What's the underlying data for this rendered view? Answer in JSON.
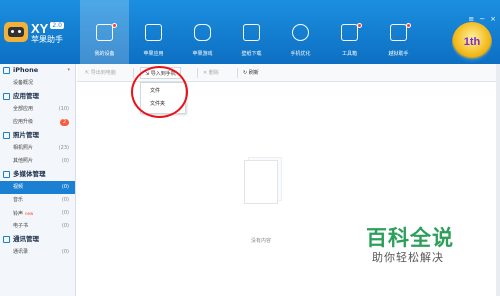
{
  "header": {
    "brand_logo_text": "XY",
    "brand_version": "2.0",
    "brand_name": "苹果助手",
    "nav": [
      {
        "label": "我的设备",
        "icon": "phone-icon",
        "active": true,
        "dot": true
      },
      {
        "label": "苹果应用",
        "icon": "apps-icon",
        "active": false,
        "dot": false
      },
      {
        "label": "苹果游戏",
        "icon": "gamepad-icon",
        "active": false,
        "dot": false
      },
      {
        "label": "壁纸下载",
        "icon": "image-icon",
        "active": false,
        "dot": false
      },
      {
        "label": "手机优化",
        "icon": "plus-circle-icon",
        "active": false,
        "dot": false
      },
      {
        "label": "工具箱",
        "icon": "toolbox-icon",
        "active": false,
        "dot": true
      },
      {
        "label": "越狱助手",
        "icon": "exit-icon",
        "active": false,
        "dot": true
      }
    ],
    "window_controls": [
      "≡",
      "−",
      "×"
    ],
    "badge_text": "1th"
  },
  "sidebar": {
    "device": "iPhone",
    "items": [
      {
        "label": "设备概况",
        "count": ""
      },
      {
        "label": "应用管理",
        "section": true
      },
      {
        "label": "全部应用",
        "count": "(10)"
      },
      {
        "label": "应用升级",
        "pill": "2"
      },
      {
        "label": "照片管理",
        "section": true
      },
      {
        "label": "相机照片",
        "count": "(23)"
      },
      {
        "label": "其他照片",
        "count": "(0)"
      },
      {
        "label": "多媒体管理",
        "section": true
      },
      {
        "label": "视频",
        "count": "(0)",
        "active": true
      },
      {
        "label": "音乐",
        "count": "(0)"
      },
      {
        "label": "铃声",
        "count": "(0)",
        "new": "new"
      },
      {
        "label": "电子书",
        "count": "(0)"
      },
      {
        "label": "通讯管理",
        "section": true
      },
      {
        "label": "通讯录",
        "count": "(0)"
      }
    ]
  },
  "toolbar": {
    "export": "导出到电脑",
    "import": "导入到手机",
    "delete": "删除",
    "refresh": "刷新"
  },
  "dropdown": {
    "items": [
      "文件",
      "文件夹"
    ]
  },
  "content": {
    "empty_text": "没有内容"
  },
  "watermark": {
    "main": "百科全说",
    "sub": "助你轻松解决"
  },
  "colors": {
    "header_blue": "#1c8fe0",
    "active_blue": "#1b7fd2",
    "annotation_red": "#e8141a",
    "watermark_green": "#2c9f5a"
  }
}
